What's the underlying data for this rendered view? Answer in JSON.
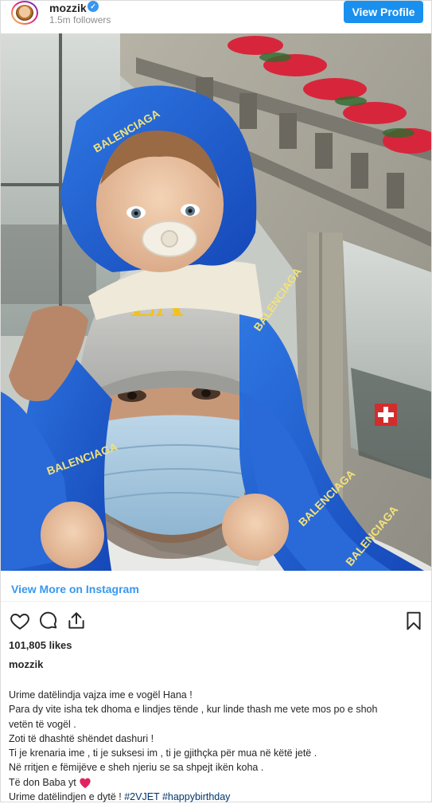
{
  "header": {
    "username": "mozzik",
    "followers": "1.5m followers",
    "view_profile_label": "View Profile"
  },
  "post": {
    "cap_text": "LA",
    "hoodie_text": "BALENCIAGA",
    "view_more_label": "View More on Instagram",
    "likes": "101,805 likes",
    "caption_username": "mozzik",
    "caption_lines": [
      "Urime datëlindja vajza ime e vogël Hana !",
      "Para dy vite isha tek dhoma e lindjes tënde , kur linde thash me vete mos po e shoh",
      "vetën të vogël .",
      "Zoti të dhashtë shëndet dashuri !",
      "Ti je krenaria ime , ti je suksesi im , ti je gjithçka për mua në këtë jetë .",
      "Në rritjen e fëmijëve e sheh njeriu se sa shpejt ikën koha .",
      "Të don Baba yt"
    ],
    "last_line_text": "Urime datëlindjen e dytë ! ",
    "hashtags": [
      "#2VJET",
      "#happybirthday"
    ]
  },
  "colors": {
    "accent": "#1a90ee",
    "link": "#3897f0",
    "hashtag": "#00376b",
    "hoodie": "#1f5fd6",
    "cap_logo": "#f2c21a",
    "heart": "#e0245e"
  },
  "icons": [
    "heart-icon",
    "comment-icon",
    "share-icon",
    "bookmark-icon",
    "verified-badge-icon"
  ]
}
